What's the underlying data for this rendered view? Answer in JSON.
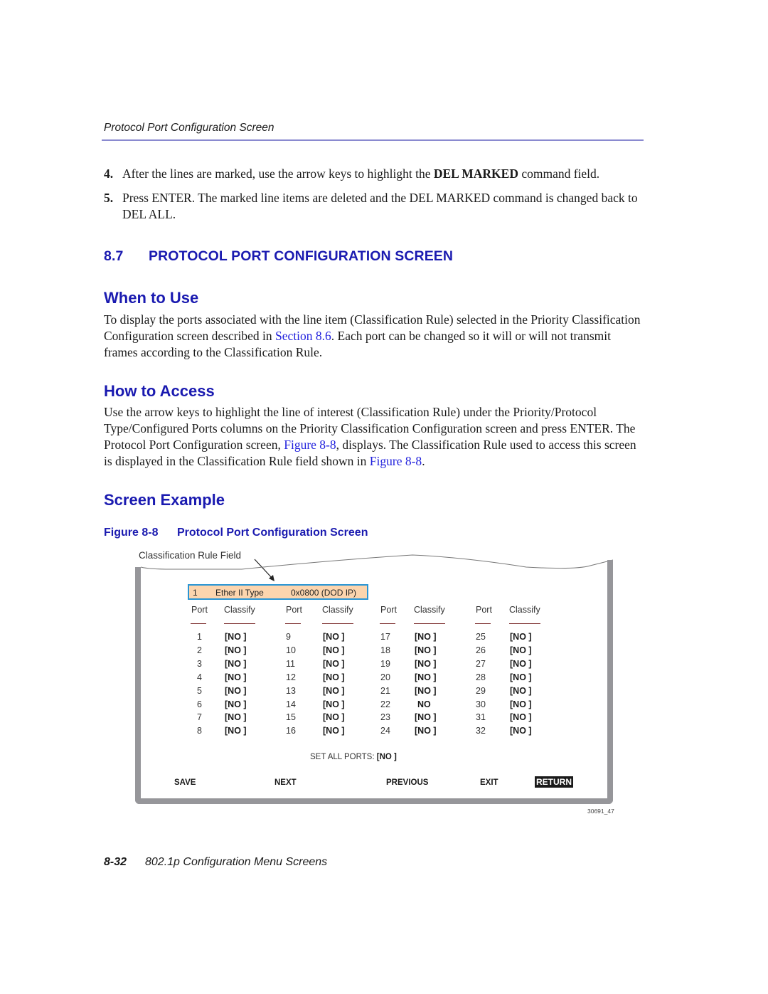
{
  "running_header": "Protocol Port Configuration Screen",
  "steps": [
    {
      "num": "4.",
      "pre": "After the lines are marked, use the arrow keys to highlight the ",
      "bold": "DEL MARKED",
      "post": " command field."
    },
    {
      "num": "5.",
      "text": "Press ENTER. The marked line items are deleted and the DEL MARKED command is changed back to DEL ALL."
    }
  ],
  "section": {
    "number": "8.7",
    "title": "PROTOCOL PORT CONFIGURATION SCREEN"
  },
  "when_to_use": {
    "heading": "When to Use",
    "text_pre": "To display the ports associated with the line item (Classification Rule) selected in the Priority Classification Configuration screen described in ",
    "link": "Section 8.6",
    "text_post": ". Each port can be changed so it will or will not transmit frames according to the Classification Rule."
  },
  "how_to_access": {
    "heading": "How to Access",
    "text_1": "Use the arrow keys to highlight the line of interest (Classification Rule) under the Priority/Protocol Type/Configured Ports columns on the Priority Classification Configuration screen and press ENTER. The Protocol Port Configuration screen, ",
    "link_1": "Figure 8-8",
    "text_2": ", displays. The Classification Rule used to access this screen is displayed in the Classification Rule field shown in ",
    "link_2": "Figure 8-8",
    "text_3": "."
  },
  "screen_example": {
    "heading": "Screen Example",
    "figure_label": "Figure 8-8",
    "figure_title": "Protocol Port Configuration Screen",
    "callout": "Classification Rule Field",
    "rule_field": {
      "index": "1",
      "type": "Ether II Type",
      "value": "0x0800  (DOD IP)"
    },
    "col_headers": {
      "port": "Port",
      "classify": "Classify"
    },
    "ports": [
      {
        "port": "1",
        "classify": "[NO ]"
      },
      {
        "port": "2",
        "classify": "[NO ]"
      },
      {
        "port": "3",
        "classify": "[NO ]"
      },
      {
        "port": "4",
        "classify": "[NO ]"
      },
      {
        "port": "5",
        "classify": "[NO ]"
      },
      {
        "port": "6",
        "classify": "[NO ]"
      },
      {
        "port": "7",
        "classify": "[NO ]"
      },
      {
        "port": "8",
        "classify": "[NO ]"
      },
      {
        "port": "9",
        "classify": "[NO ]"
      },
      {
        "port": "10",
        "classify": "[NO ]"
      },
      {
        "port": "11",
        "classify": "[NO ]"
      },
      {
        "port": "12",
        "classify": "[NO ]"
      },
      {
        "port": "13",
        "classify": "[NO ]"
      },
      {
        "port": "14",
        "classify": "[NO ]"
      },
      {
        "port": "15",
        "classify": "[NO ]"
      },
      {
        "port": "16",
        "classify": "[NO ]"
      },
      {
        "port": "17",
        "classify": "[NO ]"
      },
      {
        "port": "18",
        "classify": "[NO ]"
      },
      {
        "port": "19",
        "classify": "[NO ]"
      },
      {
        "port": "20",
        "classify": "[NO ]"
      },
      {
        "port": "21",
        "classify": "[NO ]"
      },
      {
        "port": "22",
        "classify": "NO"
      },
      {
        "port": "23",
        "classify": "[NO ]"
      },
      {
        "port": "24",
        "classify": "[NO ]"
      },
      {
        "port": "25",
        "classify": "[NO ]"
      },
      {
        "port": "26",
        "classify": "[NO ]"
      },
      {
        "port": "27",
        "classify": "[NO ]"
      },
      {
        "port": "28",
        "classify": "[NO ]"
      },
      {
        "port": "29",
        "classify": "[NO ]"
      },
      {
        "port": "30",
        "classify": "[NO ]"
      },
      {
        "port": "31",
        "classify": "[NO ]"
      },
      {
        "port": "32",
        "classify": "[NO ]"
      }
    ],
    "set_all_label": "SET ALL PORTS: ",
    "set_all_value": "[NO ]",
    "commands": {
      "save": "SAVE",
      "next": "NEXT",
      "previous": "PREVIOUS",
      "exit": "EXIT",
      "return": "RETURN"
    },
    "figure_id": "30691_47"
  },
  "footer": {
    "page": "8-32",
    "title": "802.1p Configuration Menu Screens"
  },
  "colors": {
    "heading_blue": "#1a1ab0",
    "link_blue": "#2222dd",
    "highlight_fill": "#fcd5ae",
    "highlight_border": "#2a95d4",
    "frame_gray": "#96969a"
  }
}
